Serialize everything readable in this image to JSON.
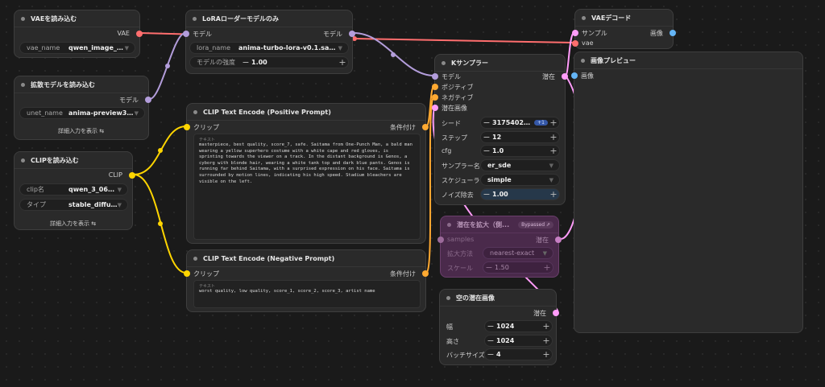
{
  "colors": {
    "vae": "#ff6e6e",
    "model": "#b39ddb",
    "clip": "#ffd500",
    "conditioning": "#ffa931",
    "latent": "#ff9cf9",
    "image": "#64b5f6"
  },
  "nodes": {
    "vae_loader": {
      "title": "VAEを読み込む",
      "output": "VAE",
      "widget_name": "vae_name",
      "widget_value": "qwen_image_v..."
    },
    "unet_loader": {
      "title": "拡散モデルを読み込む",
      "output": "モデル",
      "widget_name": "unet_name",
      "widget_value": "anima-preview3-ba...",
      "advanced": "詳細入力を表示"
    },
    "clip_loader": {
      "title": "CLIPを読み込む",
      "output": "CLIP",
      "w1_name": "clip名",
      "w1_value": "qwen_3_06b_...",
      "w2_name": "タイプ",
      "w2_value": "stable_diffusion",
      "advanced": "詳細入力を表示"
    },
    "lora": {
      "title": "LoRAローダーモデルのみ",
      "input": "モデル",
      "output": "モデル",
      "w1_name": "lora_name",
      "w1_value": "anima-turbo-lora-v0.1.safeten...",
      "w2_name": "モデルの強度",
      "w2_value": "1.00"
    },
    "pos": {
      "title": "CLIP Text Encode (Positive Prompt)",
      "input": "クリップ",
      "output": "条件付け",
      "text_label": "テキスト",
      "text": "masterpiece, best quality, score_7, safe. Saitama from One-Punch Man, a bald man wearing a yellow superhero costume with a white cape and red gloves, is sprinting towards the viewer on a track. In the distant background is Genos, a cyborg with blonde hair, wearing a white tank top and dark blue pants. Genos is running far behind Saitama, with a surprised expression on his face. Saitama is surrounded by motion lines, indicating his high speed. Stadium bleachers are visible on the left."
    },
    "neg": {
      "title": "CLIP Text Encode (Negative Prompt)",
      "input": "クリップ",
      "output": "条件付け",
      "text_label": "テキスト",
      "text": "worst quality, low quality, score_1, score_2, score_3, artist name"
    },
    "ksampler": {
      "title": "Kサンプラー",
      "inputs": [
        "モデル",
        "ポジティブ",
        "ネガティブ",
        "潜在画像"
      ],
      "output": "潜在",
      "seed_name": "シード",
      "seed_value": "31754028...",
      "seed_badge": "+1",
      "steps_name": "ステップ",
      "steps_value": "12",
      "cfg_name": "cfg",
      "cfg_value": "1.0",
      "sampler_name": "サンプラー名",
      "sampler_value": "er_sde",
      "scheduler_name": "スケジューラ",
      "scheduler_value": "simple",
      "denoise_name": "ノイズ除去",
      "denoise_value": "1.00"
    },
    "vae_decode": {
      "title": "VAEデコード",
      "inputs": [
        "サンプル",
        "vae"
      ],
      "output": "画像"
    },
    "preview": {
      "title": "画像プレビュー",
      "input": "画像"
    },
    "upscale": {
      "title": "潜在を拡大（側...",
      "badge": "Bypassed",
      "input": "samples",
      "output": "潜在",
      "w1_name": "拡大方法",
      "w1_value": "nearest-exact",
      "w2_name": "スケール",
      "w2_value": "1.50"
    },
    "empty_latent": {
      "title": "空の潜在画像",
      "output": "潜在",
      "w1_name": "幅",
      "w1_value": "1024",
      "w2_name": "高さ",
      "w2_value": "1024",
      "w3_name": "バッチサイズ",
      "w3_value": "4"
    }
  }
}
